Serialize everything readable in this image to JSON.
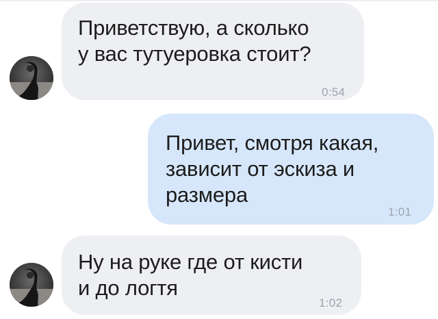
{
  "messages": [
    {
      "direction": "incoming",
      "text": "Приветствую, а сколько\nу вас тутуеровка стоит?",
      "time": "0:54"
    },
    {
      "direction": "outgoing",
      "text": "Привет, смотря какая,\nзависит от эскиза и\nразмера",
      "time": "1:01"
    },
    {
      "direction": "incoming",
      "text": "Ну на руке где от кисти\nи до логтя",
      "time": "1:02"
    }
  ],
  "colors": {
    "incoming_bubble": "#eeeff2",
    "outgoing_bubble": "#d7e7fb",
    "text": "#1c1c1c",
    "timestamp": "#9aa3ad"
  }
}
